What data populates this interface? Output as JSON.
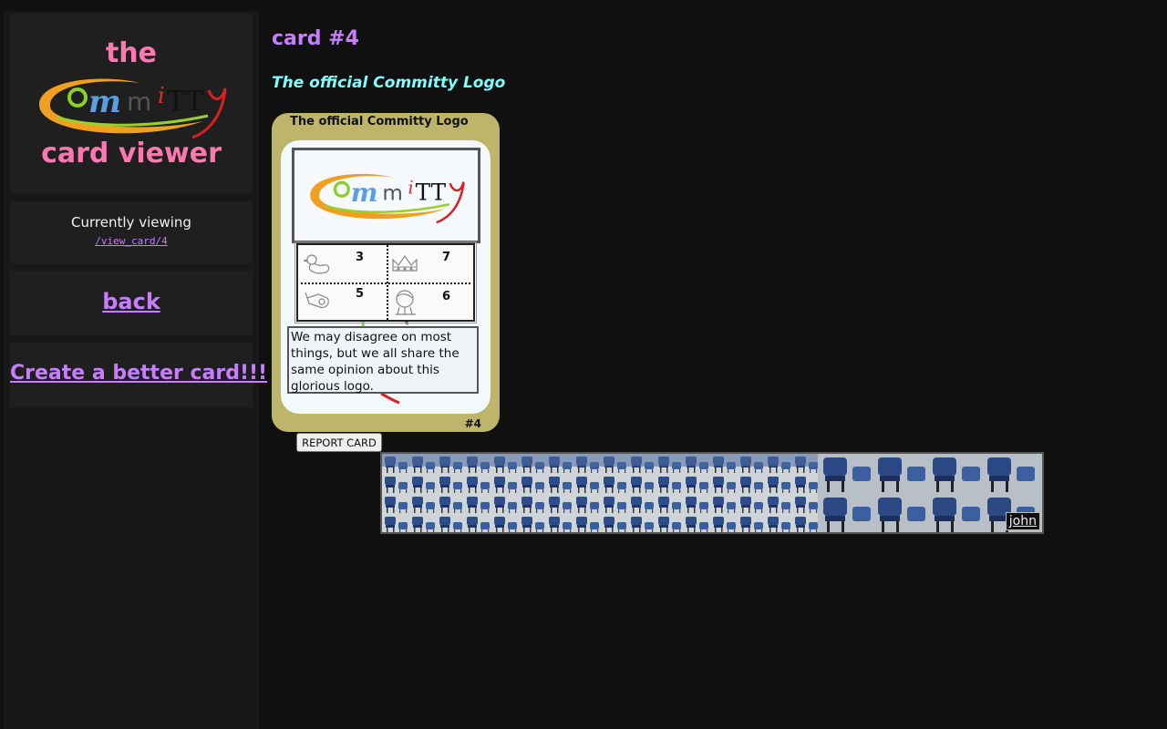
{
  "sidebar": {
    "title_the": "the",
    "logo_alt": "Committy",
    "title_card_viewer": "card viewer",
    "currently_viewing_label": "Currently viewing",
    "current_path": "/view_card/4",
    "back_label": "back",
    "create_label": "Create a better card!!!"
  },
  "main": {
    "card_heading": "card #4",
    "card_subtitle": "The official Committy Logo"
  },
  "card": {
    "name": "The official Committy Logo",
    "stats": [
      {
        "icon": "duck-icon",
        "value": "3"
      },
      {
        "icon": "crown-icon",
        "value": "7"
      },
      {
        "icon": "whistle-icon",
        "value": "5"
      },
      {
        "icon": "pudding-icon",
        "value": "6"
      }
    ],
    "description": "We may disagree on most things, but we all share the same opinion about this glorious logo.",
    "number": "#4"
  },
  "report_button": "REPORT CARD",
  "banner": {
    "user": "john"
  },
  "colors": {
    "pink": "#ff79b0",
    "purple": "#c77dff",
    "cyan": "#80ffff",
    "card_frame": "#bdb56a"
  }
}
